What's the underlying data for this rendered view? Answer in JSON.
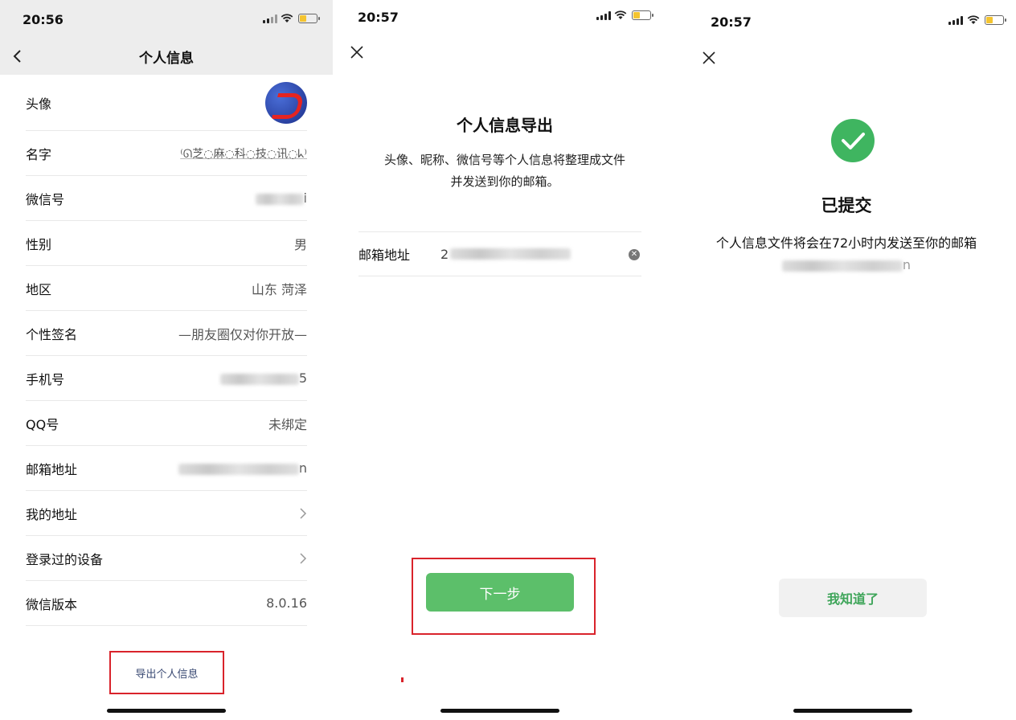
{
  "screen1": {
    "time": "20:56",
    "title": "个人信息",
    "rows": [
      {
        "label": "头像",
        "value": ""
      },
      {
        "label": "名字",
        "value": "⁽ᘏ芝◌麻◌科◌技◌讯◌ᖾ⁾"
      },
      {
        "label": "微信号",
        "value": "i"
      },
      {
        "label": "性别",
        "value": "男"
      },
      {
        "label": "地区",
        "value": "山东 菏泽"
      },
      {
        "label": "个性签名",
        "value": "—朋友圈仅对你开放—"
      },
      {
        "label": "手机号",
        "value": "5"
      },
      {
        "label": "QQ号",
        "value": "未绑定"
      },
      {
        "label": "邮箱地址",
        "value": "n"
      },
      {
        "label": "我的地址",
        "value": ""
      },
      {
        "label": "登录过的设备",
        "value": ""
      },
      {
        "label": "微信版本",
        "value": "8.0.16"
      }
    ],
    "export_label": "导出个人信息"
  },
  "screen2": {
    "time": "20:57",
    "title": "个人信息导出",
    "desc_line1": "头像、昵称、微信号等个人信息将整理成文件",
    "desc_line2": "并发送到你的邮箱。",
    "email_label": "邮箱地址",
    "email_value": "2",
    "next_label": "下一步"
  },
  "screen3": {
    "time": "20:57",
    "title": "已提交",
    "desc": "个人信息文件将会在72小时内发送至你的邮箱",
    "email_tail": "n",
    "gotit_label": "我知道了"
  },
  "colors": {
    "accent_green": "#5cbf6a",
    "check_green": "#3fb560",
    "highlight_red": "#d9232b",
    "link_blue": "#3a4a73"
  }
}
